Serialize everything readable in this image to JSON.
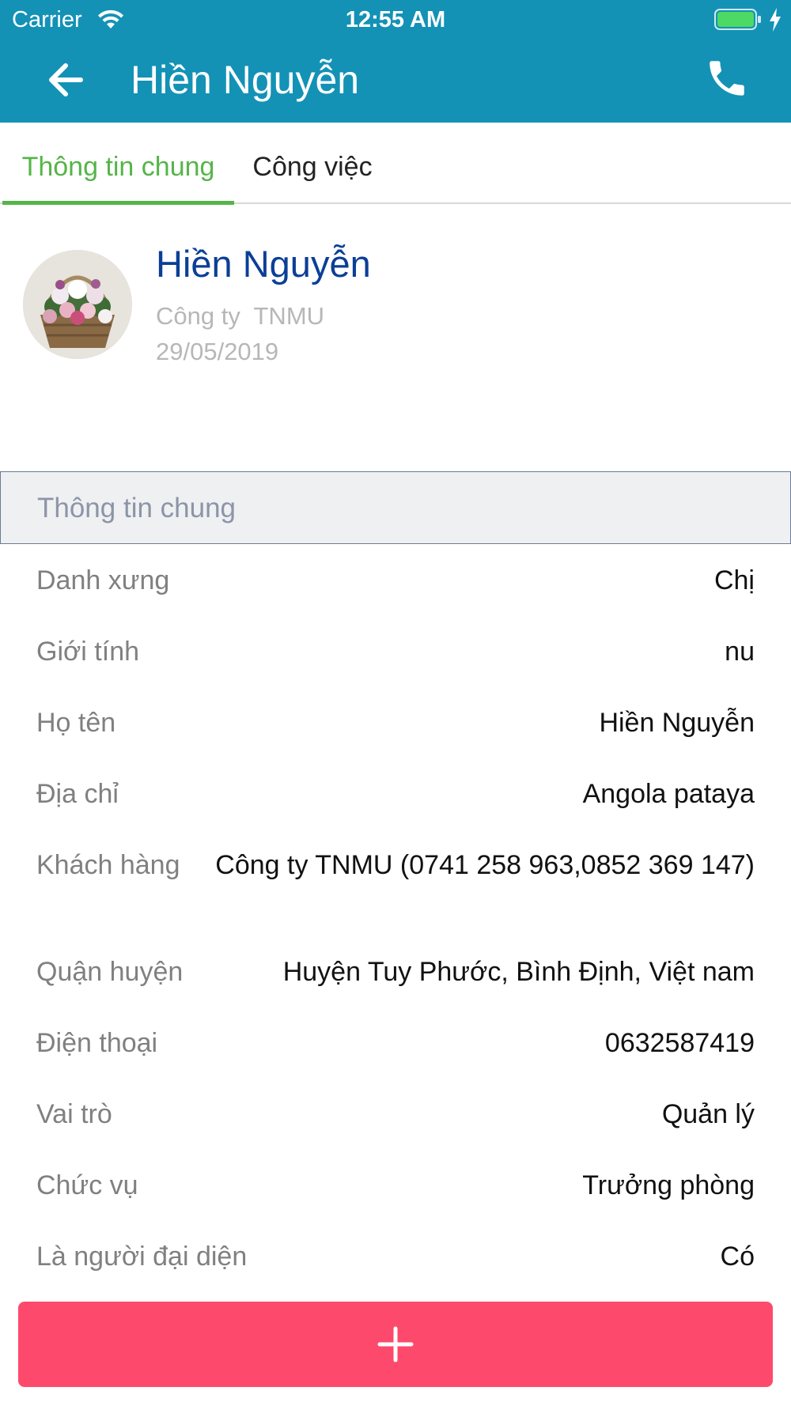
{
  "status_bar": {
    "carrier": "Carrier",
    "time": "12:55 AM"
  },
  "nav": {
    "title": "Hiền Nguyễn",
    "back_icon": "arrow-left-icon",
    "call_icon": "phone-icon"
  },
  "tabs": [
    {
      "label": "Thông tin chung",
      "active": true
    },
    {
      "label": "Công việc",
      "active": false
    }
  ],
  "profile": {
    "name": "Hiền Nguyễn",
    "company": "Công ty  TNMU",
    "date": "29/05/2019"
  },
  "section": {
    "title": "Thông tin chung"
  },
  "rows": [
    {
      "label": "Danh xưng",
      "value": "Chị"
    },
    {
      "label": "Giới tính",
      "value": "nu"
    },
    {
      "label": "Họ tên",
      "value": "Hiền Nguyễn"
    },
    {
      "label": "Địa chỉ",
      "value": "Angola pataya"
    },
    {
      "label": "Khách hàng",
      "value": "Công ty  TNMU (0741 258 963,0852 369 147)"
    },
    {
      "label": "Quận huyện",
      "value": "Huyện Tuy Phước, Bình Định, Việt nam"
    },
    {
      "label": "Điện thoại",
      "value": "0632587419"
    },
    {
      "label": "Vai trò",
      "value": "Quản lý"
    },
    {
      "label": "Chức vụ",
      "value": "Trưởng phòng"
    },
    {
      "label": "Là người đại diện",
      "value": "Có"
    }
  ],
  "colors": {
    "header": "#1392b6",
    "tab_active": "#55b548",
    "name": "#0b3f96",
    "add_button": "#fd4a6c"
  }
}
